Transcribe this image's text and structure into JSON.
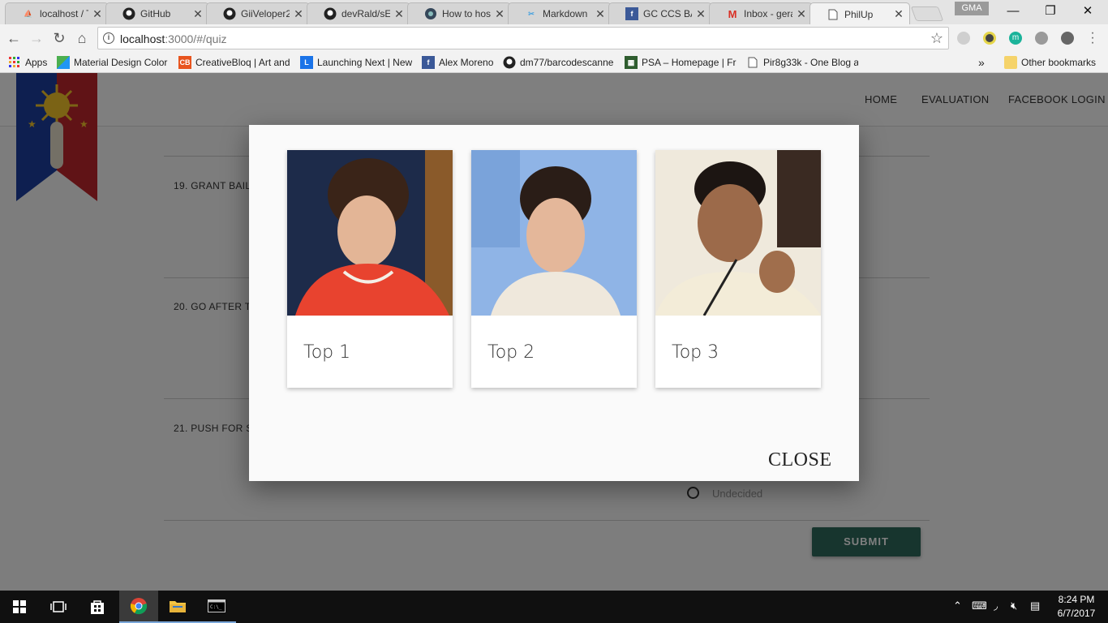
{
  "browser": {
    "tabs": [
      {
        "title": "localhost / T",
        "icon": "pma-icon"
      },
      {
        "title": "GitHub",
        "icon": "github-icon"
      },
      {
        "title": "GiiVeloper2",
        "icon": "github-icon"
      },
      {
        "title": "devRald/sE",
        "icon": "github-icon"
      },
      {
        "title": "How to hos",
        "icon": "globe-icon"
      },
      {
        "title": "Markdown",
        "icon": "markdown-icon"
      },
      {
        "title": "GC CCS BAT",
        "icon": "facebook-icon"
      },
      {
        "title": "Inbox - gera",
        "icon": "gmail-icon"
      },
      {
        "title": "PhilUp",
        "icon": "page-icon"
      }
    ],
    "profile_name": "GMA",
    "url_host": "localhost",
    "url_path": ":3000/#/quiz",
    "bookmarks": [
      {
        "label": "Apps",
        "icon": "apps-grid-icon"
      },
      {
        "label": "Material Design Color",
        "icon": "material-icon"
      },
      {
        "label": "CreativeBloq | Art and",
        "icon": "creativebloq-icon"
      },
      {
        "label": "Launching Next | New",
        "icon": "launching-next-icon"
      },
      {
        "label": "Alex Moreno",
        "icon": "facebook-icon"
      },
      {
        "label": "dm77/barcodescanne",
        "icon": "github-icon"
      },
      {
        "label": "PSA – Homepage | Fre",
        "icon": "psa-icon"
      },
      {
        "label": "Pir8g33k - One Blog a",
        "icon": "page-icon"
      }
    ],
    "other_bookmarks": "Other bookmarks",
    "overflow_chevron": "»"
  },
  "page": {
    "nav": [
      "HOME",
      "EVALUATION",
      "FACEBOOK LOGIN"
    ],
    "questions": [
      {
        "label": "19. GRANT BAIL"
      },
      {
        "label": "20. GO AFTER T"
      },
      {
        "label": "21. PUSH FOR S"
      }
    ],
    "radio_label": "Undecided",
    "submit_label": "SUBMIT"
  },
  "modal": {
    "cards": [
      {
        "title": "Top 1"
      },
      {
        "title": "Top 2"
      },
      {
        "title": "Top 3"
      }
    ],
    "close_label": "CLOSE"
  },
  "taskbar": {
    "time": "8:24 PM",
    "date": "6/7/2017"
  }
}
